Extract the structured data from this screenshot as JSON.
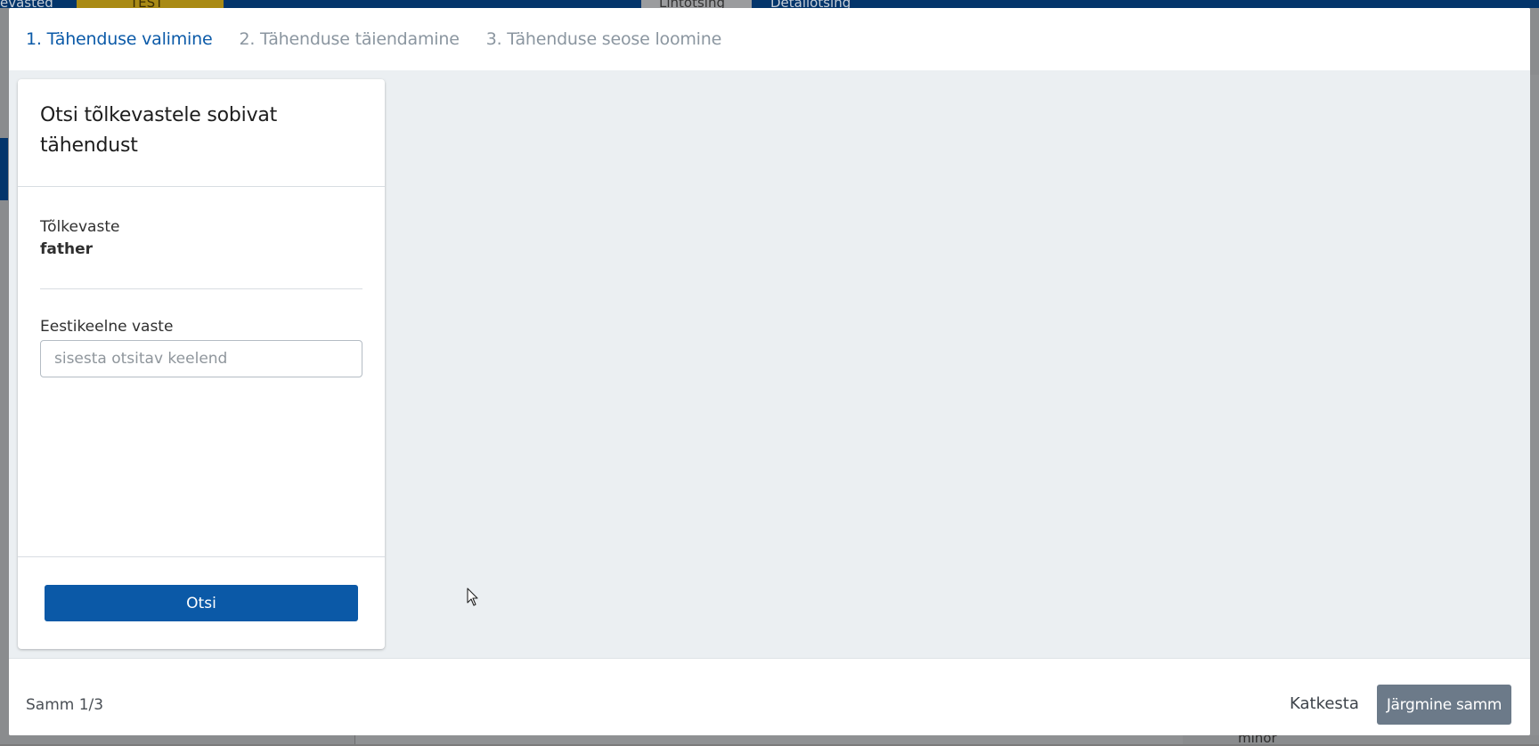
{
  "background": {
    "nav_text_left": "evasted",
    "badge_label": "TEST",
    "tab_simple_search": "Lihtotsing",
    "tab_detail_search": "Detailotsing",
    "list_item_minor": "minor"
  },
  "modal": {
    "steps": [
      {
        "label": "1. Tähenduse valimine",
        "active": true
      },
      {
        "label": "2. Tähenduse täiendamine",
        "active": false
      },
      {
        "label": "3. Tähenduse seose loomine",
        "active": false
      }
    ],
    "card": {
      "title": "Otsi tõlkevastele sobivat tähendust",
      "translation_label": "Tõlkevaste",
      "translation_value": "father",
      "estonian_label": "Eestikeelne vaste",
      "estonian_placeholder": "sisesta otsitav keelend",
      "estonian_value": "",
      "search_button": "Otsi"
    },
    "footer": {
      "step_counter": "Samm 1/3",
      "cancel_button": "Katkesta",
      "next_button": "Järgmine samm"
    }
  },
  "colors": {
    "primary": "#0b59a7",
    "active_step": "#0b5aa8",
    "inactive_step": "#8b96a0",
    "disabled_button": "#6c7a89",
    "modal_body": "#ebeff2"
  }
}
